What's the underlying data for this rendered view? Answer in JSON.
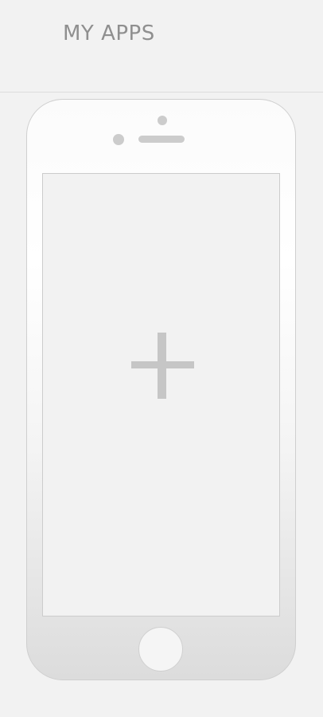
{
  "header": {
    "title": "MY APPS"
  },
  "device": {
    "screen_action_icon": "plus-icon",
    "accent_color": "#c6c6c6",
    "background_color": "#f2f2f2"
  }
}
